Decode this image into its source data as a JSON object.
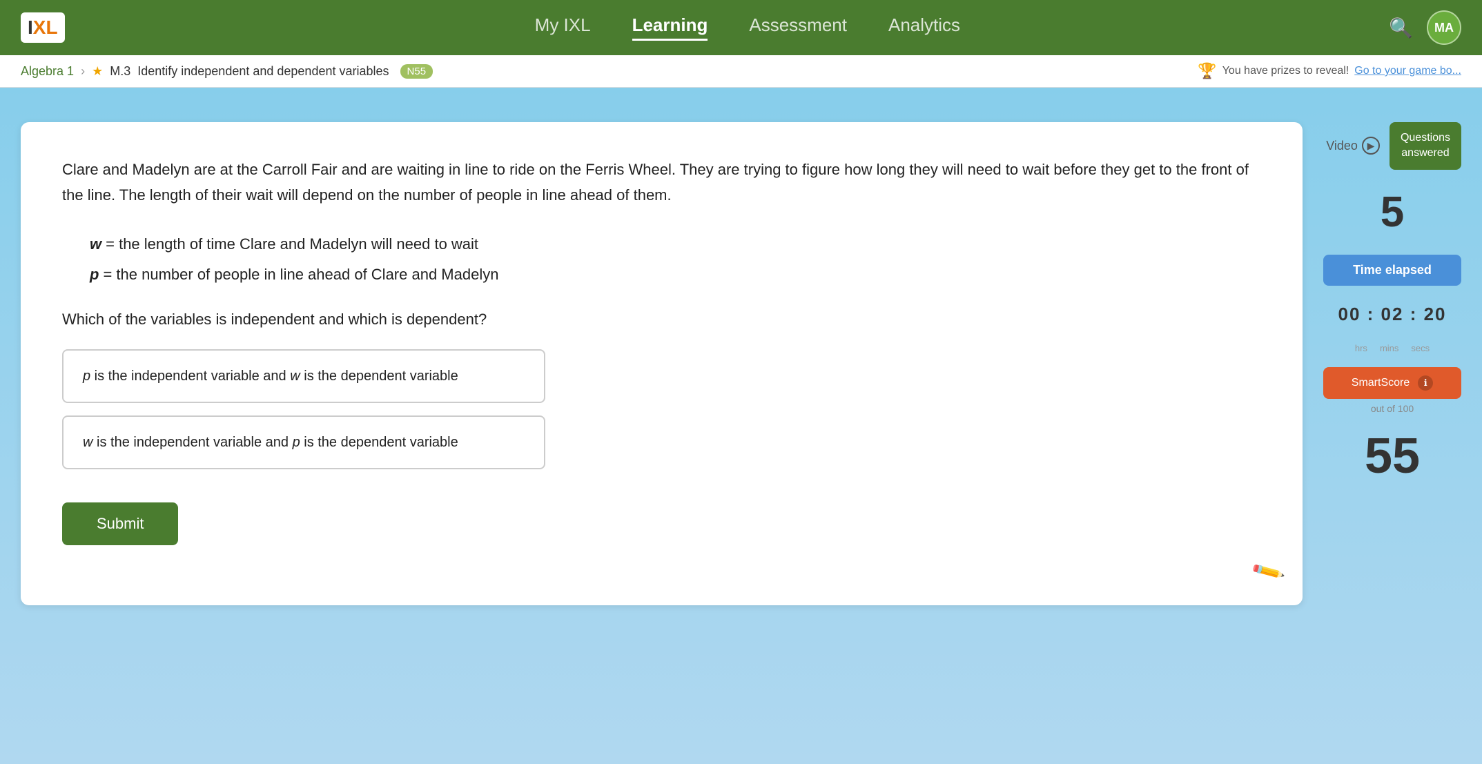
{
  "nav": {
    "logo_i": "I",
    "logo_xl": "XL",
    "links": [
      {
        "label": "My IXL",
        "active": false
      },
      {
        "label": "Learning",
        "active": true
      },
      {
        "label": "Assessment",
        "active": false
      },
      {
        "label": "Analytics",
        "active": false
      }
    ],
    "user_initials": "MA"
  },
  "breadcrumb": {
    "subject": "Algebra 1",
    "skill_code": "M.3",
    "skill_name": "Identify independent and dependent variables",
    "level": "N55",
    "prizes_text": "You have prizes to reveal!",
    "prizes_link": "Go to your game bo..."
  },
  "question": {
    "passage": "Clare and Madelyn are at the Carroll Fair and are waiting in line to ride on the Ferris Wheel. They are trying to figure how long they will need to wait before they get to the front of the line. The length of their wait will depend on the number of people in line ahead of them.",
    "var1_letter": "w",
    "var1_def": "= the length of time Clare and Madelyn will need to wait",
    "var2_letter": "p",
    "var2_def": "= the number of people in line ahead of Clare and Madelyn",
    "prompt": "Which of the variables is independent and which is dependent?",
    "options": [
      {
        "id": "A",
        "text_italic_start": "p",
        "text_middle": " is the independent variable and ",
        "text_italic_end": "w",
        "text_suffix": " is the dependent variable"
      },
      {
        "id": "B",
        "text_italic_start": "w",
        "text_middle": " is the independent variable and ",
        "text_italic_end": "p",
        "text_suffix": " is the dependent variable"
      }
    ],
    "submit_label": "Submit",
    "video_label": "Video"
  },
  "sidebar": {
    "video_label": "Video",
    "questions_answered_label": "Questions\nanswered",
    "questions_answered_value": "5",
    "time_elapsed_label": "Time\nelapsed",
    "timer_hours": "00",
    "timer_minutes": "02",
    "timer_seconds": "20",
    "timer_label_h": "hrs",
    "timer_label_m": "mins",
    "timer_label_s": "secs",
    "smartscore_label": "SmartScore",
    "smartscore_sublabel": "out of 100",
    "smartscore_value": "55"
  }
}
